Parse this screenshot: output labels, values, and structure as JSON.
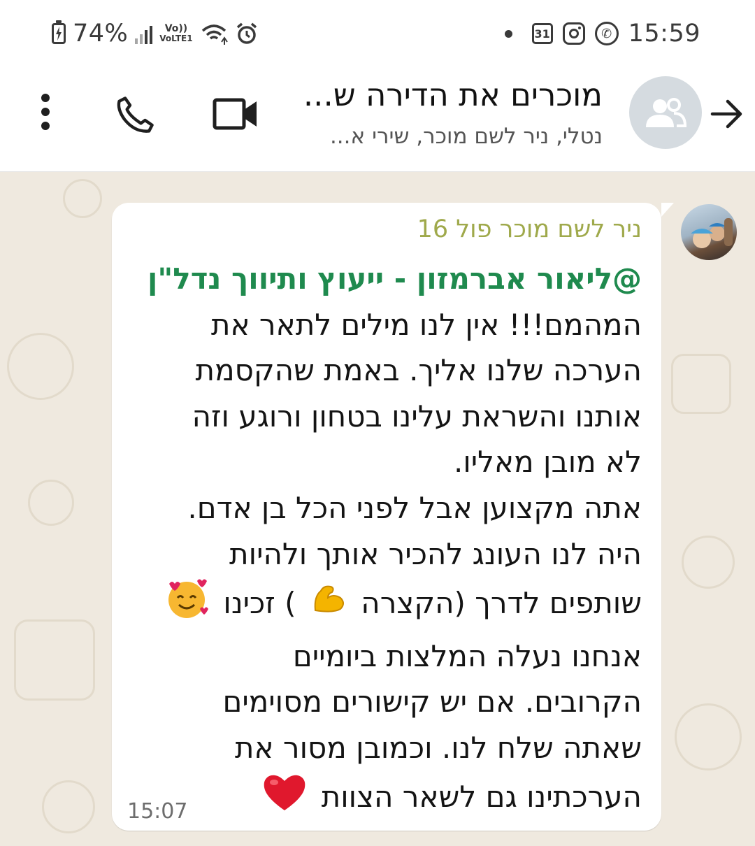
{
  "status_bar": {
    "battery": "74%",
    "network": "VoLTE1",
    "calendar_day": "31",
    "time": "15:59"
  },
  "header": {
    "title": "מוכרים את הדירה ש...",
    "subtitle": "נטלי, ניר לשם מוכר, שירי א...",
    "icons": [
      "more-vert-icon",
      "phone-icon",
      "video-call-icon",
      "group-avatar-icon",
      "back-arrow-icon"
    ]
  },
  "message": {
    "sender": "ניר לשם מוכר פול 16",
    "mention": "@ליאור אברמזון - ייעוץ ותיווך נדל\"ן",
    "lines": [
      "המהמם!!! אין לנו מילים לתאר את",
      "הערכה שלנו אליך. באמת שהקסמת",
      "אותנו והשראת עלינו בטחון ורוגע  וזה",
      "לא מובן מאליו.",
      "אתה מקצוען אבל לפני הכל בן אדם.",
      "היה לנו העונג להכיר אותך ולהיות"
    ],
    "line7_a": "שותפים לדרך (הקצרה",
    "line7_b": ") זכינו",
    "lines_after": [
      "אנחנו נעלה המלצות ביומיים",
      "הקרובים. אם יש קישורים מסוימים",
      "שאתה שלח לנו. וכמובן מסור את"
    ],
    "last_line": "הערכתינו גם לשאר הצוות",
    "time": "15:07",
    "emojis": [
      "flexed-biceps",
      "smiling-face-with-hearts",
      "red-heart"
    ]
  }
}
